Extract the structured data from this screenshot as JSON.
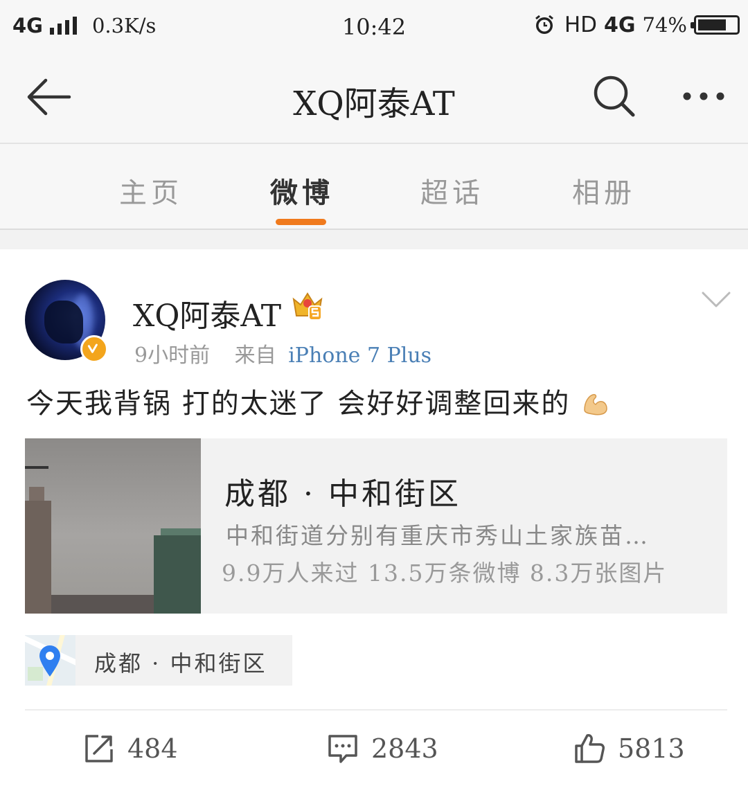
{
  "status_bar": {
    "network": "4G",
    "speed": "0.3K/s",
    "time": "10:42",
    "hd": "HD",
    "lte": "4G",
    "battery_pct": "74%",
    "battery_level": 0.74
  },
  "nav": {
    "title": "XQ阿泰AT",
    "icons": [
      "back-arrow-icon",
      "search-icon",
      "more-icon"
    ]
  },
  "tabs": [
    {
      "label": "主页",
      "active": false
    },
    {
      "label": "微博",
      "active": true
    },
    {
      "label": "超话",
      "active": false
    },
    {
      "label": "相册",
      "active": false
    }
  ],
  "post": {
    "username": "XQ阿泰AT",
    "time_ago": "9小时前",
    "source_label": "来自",
    "device": "iPhone 7 Plus",
    "text": "今天我背锅 打的太迷了 会好好调整回来的",
    "emoji": "muscle-emoji",
    "place_card": {
      "title": "成都 · 中和街区",
      "description": "中和街道分别有重庆市秀山土家族苗…",
      "stats": "9.9万人来过 13.5万条微博 8.3万张图片"
    },
    "location": "成都 · 中和街区",
    "actions": {
      "repost_count": "484",
      "comment_count": "2843",
      "like_count": "5813"
    }
  },
  "colors": {
    "accent": "#f07a1d",
    "link": "#4a7fb5",
    "verified": "#f3a51c",
    "pin": "#2f7ff0"
  }
}
